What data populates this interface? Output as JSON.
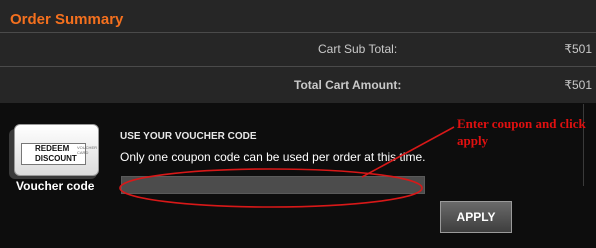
{
  "order_summary": {
    "title": "Order Summary",
    "subtotal_label": "Cart Sub Total:",
    "subtotal_value": "₹501",
    "total_label": "Total Cart Amount:",
    "total_value": "₹501"
  },
  "voucher": {
    "card_text": "REDEEM DISCOUNT",
    "card_small_text": "VOUCHER CARD",
    "caption": "Voucher code",
    "heading": "USE YOUR VOUCHER CODE",
    "note": "Only one coupon code can be used per order at this time.",
    "input_value": "",
    "apply_label": "APPLY"
  },
  "annotation": {
    "text": "Enter coupon and click apply",
    "color": "#e01010"
  },
  "colors": {
    "accent": "#f4701e",
    "summary_bg": "#262626",
    "voucher_bg": "#0d0d0d"
  }
}
